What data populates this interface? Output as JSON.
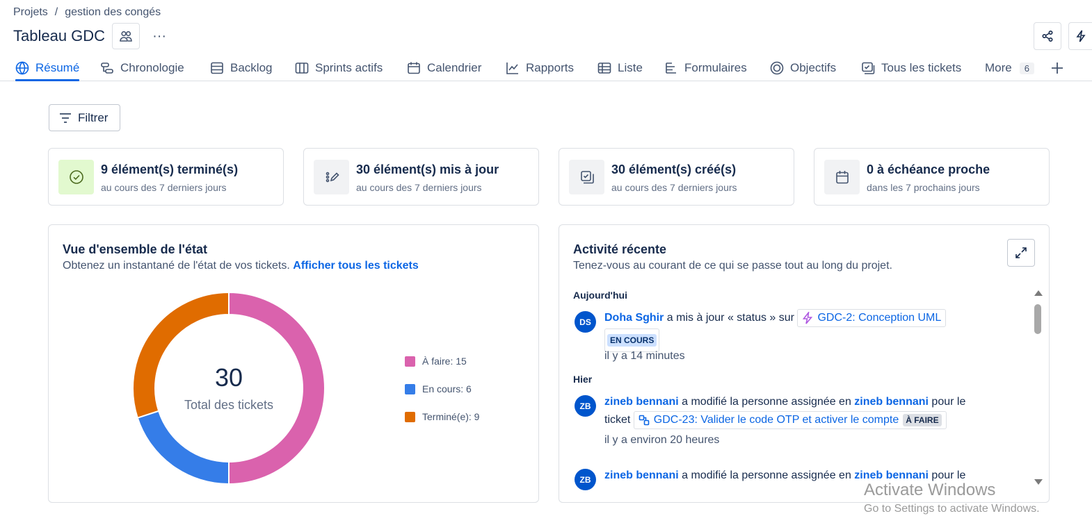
{
  "breadcrumb": {
    "root": "Projets",
    "separator": "/",
    "project": "gestion des congés"
  },
  "header": {
    "title": "Tableau GDC",
    "more": "···"
  },
  "tabs": [
    {
      "label": "Résumé",
      "icon": "globe-icon"
    },
    {
      "label": "Chronologie",
      "icon": "timeline-icon"
    },
    {
      "label": "Backlog",
      "icon": "backlog-icon"
    },
    {
      "label": "Sprints actifs",
      "icon": "board-icon"
    },
    {
      "label": "Calendrier",
      "icon": "calendar-icon"
    },
    {
      "label": "Rapports",
      "icon": "chart-line-icon"
    },
    {
      "label": "Liste",
      "icon": "list-icon"
    },
    {
      "label": "Formulaires",
      "icon": "form-icon"
    },
    {
      "label": "Objectifs",
      "icon": "target-icon"
    },
    {
      "label": "Tous les tickets",
      "icon": "tickets-icon"
    },
    {
      "label": "More",
      "icon": ""
    }
  ],
  "more_count": "6",
  "filter": {
    "label": "Filtrer"
  },
  "stats": [
    {
      "title": "9 élément(s) terminé(s)",
      "subtitle": "au cours des 7 derniers jours",
      "icon": "check-circle-icon"
    },
    {
      "title": "30 élément(s) mis à jour",
      "subtitle": "au cours des 7 derniers jours",
      "icon": "edit-icon"
    },
    {
      "title": "30 élément(s) créé(s)",
      "subtitle": "au cours des 7 derniers jours",
      "icon": "created-icon"
    },
    {
      "title": "0 à échéance proche",
      "subtitle": "dans les 7 prochains jours",
      "icon": "calendar-icon"
    }
  ],
  "status_overview": {
    "title": "Vue d'ensemble de l'état",
    "description": "Obtenez un instantané de l'état de vos tickets.",
    "link": "Afficher tous les tickets",
    "total": "30",
    "total_label": "Total des tickets"
  },
  "chart_data": {
    "type": "pie",
    "categories": [
      "À faire",
      "En cours",
      "Terminé(e)"
    ],
    "values": [
      15,
      6,
      9
    ],
    "colors": [
      "#da62ad",
      "#357de8",
      "#e06c00"
    ],
    "legend_labels": [
      "À faire: 15",
      "En cours: 6",
      "Terminé(e): 9"
    ]
  },
  "activity": {
    "title": "Activité récente",
    "description": "Tenez-vous au courant de ce qui se passe tout au long du projet.",
    "today_label": "Aujourd'hui",
    "yesterday_label": "Hier",
    "items": [
      {
        "initials": "DS",
        "user": "Doha Sghir",
        "action": "a mis à jour « status » sur",
        "ticket": "GDC-2: Conception UML",
        "status": "EN COURS",
        "time": "il y a 14 minutes"
      },
      {
        "initials": "ZB",
        "user": "zineb bennani",
        "action": "a modifié la personne assignée en",
        "target_user": "zineb bennani",
        "suffix": "pour le ticket",
        "ticket": "GDC-23: Valider le code OTP et activer le compte",
        "status": "À FAIRE",
        "time": "il y a environ 20 heures"
      },
      {
        "initials": "ZB",
        "user": "zineb bennani",
        "action": "a modifié la personne assignée en",
        "target_user": "zineb bennani",
        "suffix": "pour le"
      }
    ]
  },
  "watermark": {
    "line1": "Activate Windows",
    "line2": "Go to Settings to activate Windows."
  },
  "colors": {
    "accent": "#0c66e4",
    "text": "#172b4d",
    "border": "#dcdfe4"
  }
}
